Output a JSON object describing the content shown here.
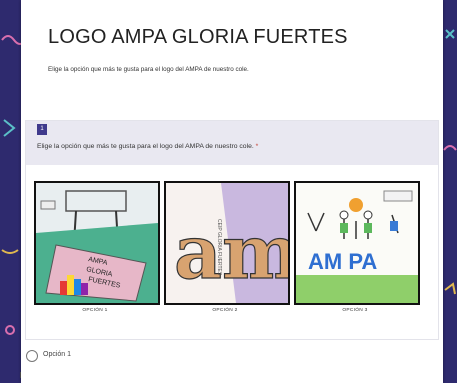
{
  "form": {
    "title": "LOGO AMPA GLORIA FUERTES",
    "description": "Elige la opción que más te gusta para el logo del AMPA de nuestro cole."
  },
  "question": {
    "number": "1",
    "text": "Elige la opción que más te gusta para el logo del AMPA de nuestro cole.",
    "required_mark": "*",
    "images": [
      {
        "caption": "OPCIÓN 1"
      },
      {
        "caption": "OPCIÓN 2"
      },
      {
        "caption": "OPCIÓN 3"
      }
    ],
    "options": [
      {
        "label": "Opción 1"
      }
    ]
  },
  "drawings": {
    "img1": {
      "l1": "AMPA",
      "l2": "GLORIA",
      "l3": "FUERTES"
    },
    "img2": {
      "letters": "am",
      "side": "CEIP GLORIA FUERTES"
    },
    "img3": {
      "letters": "AM PA"
    }
  },
  "colors": {
    "background": "#2e2a6e",
    "accent": "#3f3a8c",
    "header_band": "#e9e8f1",
    "required": "#c0392b"
  }
}
